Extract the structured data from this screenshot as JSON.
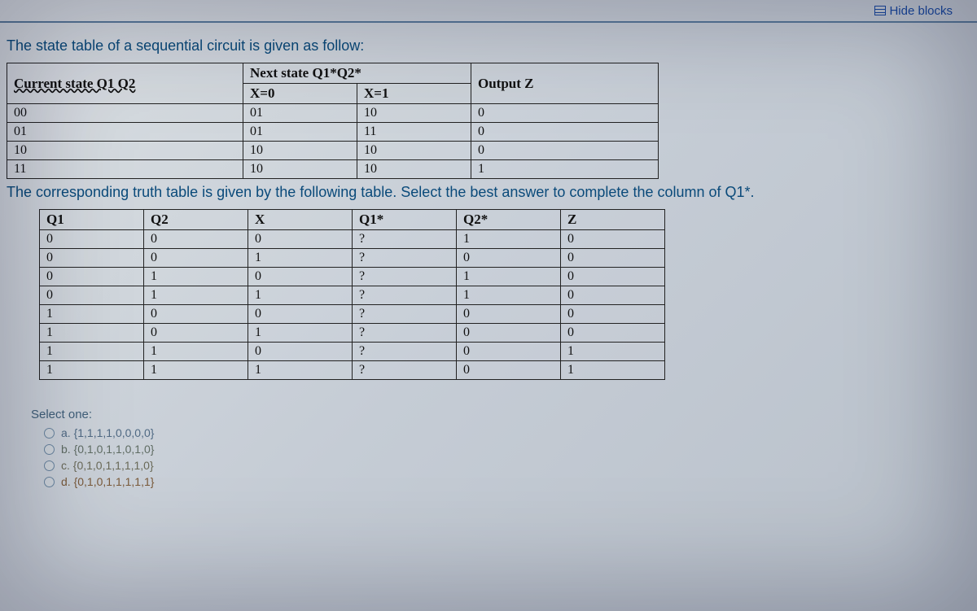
{
  "topbar": {
    "hide_blocks_label": "Hide blocks"
  },
  "intro": {
    "line1": "The state table of a sequential circuit is given as follow:",
    "line2": "The corresponding truth table is given by the following table. Select the best answer to complete the column of Q1*."
  },
  "state_table": {
    "header_current": "Current state Q1 Q2",
    "header_next": "Next state Q1*Q2*",
    "header_x0": "X=0",
    "header_x1": "X=1",
    "header_output": "Output Z",
    "rows": [
      {
        "cs": "00",
        "x0": "01",
        "x1": "10",
        "z": "0"
      },
      {
        "cs": "01",
        "x0": "01",
        "x1": "11",
        "z": "0"
      },
      {
        "cs": "10",
        "x0": "10",
        "x1": "10",
        "z": "0"
      },
      {
        "cs": "11",
        "x0": "10",
        "x1": "10",
        "z": "1"
      }
    ]
  },
  "truth_table": {
    "h_q1": "Q1",
    "h_q2": "Q2",
    "h_x": "X",
    "h_q1s": "Q1*",
    "h_q2s": "Q2*",
    "h_z": "Z",
    "rows": [
      {
        "q1": "0",
        "q2": "0",
        "x": "0",
        "q1s": "?",
        "q2s": "1",
        "z": "0"
      },
      {
        "q1": "0",
        "q2": "0",
        "x": "1",
        "q1s": "?",
        "q2s": "0",
        "z": "0"
      },
      {
        "q1": "0",
        "q2": "1",
        "x": "0",
        "q1s": "?",
        "q2s": "1",
        "z": "0"
      },
      {
        "q1": "0",
        "q2": "1",
        "x": "1",
        "q1s": "?",
        "q2s": "1",
        "z": "0"
      },
      {
        "q1": "1",
        "q2": "0",
        "x": "0",
        "q1s": "?",
        "q2s": "0",
        "z": "0"
      },
      {
        "q1": "1",
        "q2": "0",
        "x": "1",
        "q1s": "?",
        "q2s": "0",
        "z": "0"
      },
      {
        "q1": "1",
        "q2": "1",
        "x": "0",
        "q1s": "?",
        "q2s": "0",
        "z": "1"
      },
      {
        "q1": "1",
        "q2": "1",
        "x": "1",
        "q1s": "?",
        "q2s": "0",
        "z": "1"
      }
    ]
  },
  "select": {
    "title": "Select one:",
    "options": {
      "a": "a. {1,1,1,1,0,0,0,0}",
      "b": "b. {0,1,0,1,1,0,1,0}",
      "c": "c. {0,1,0,1,1,1,1,0}",
      "d": "d. {0,1,0,1,1,1,1,1}"
    }
  }
}
